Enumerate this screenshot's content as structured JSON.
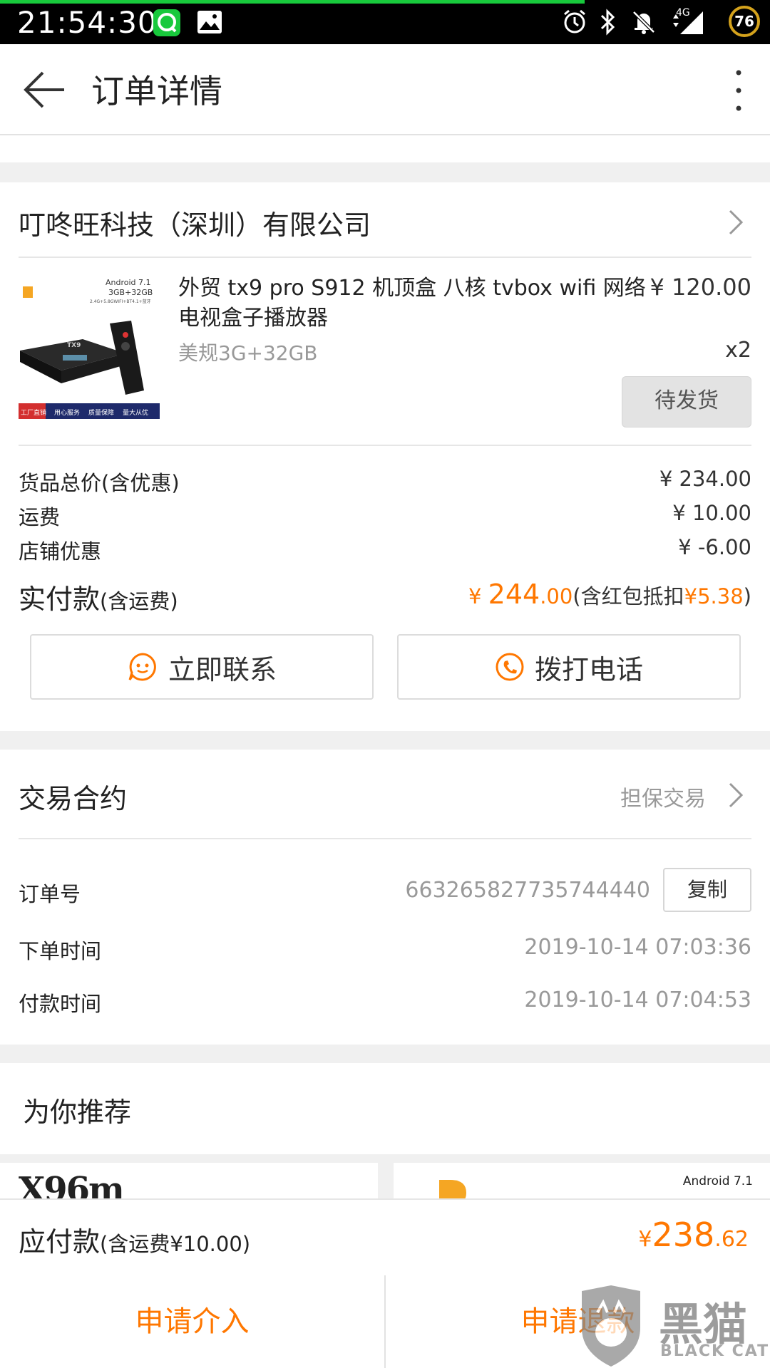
{
  "status_bar": {
    "time": "21:54:30",
    "network": "4G",
    "battery": "76",
    "icons": [
      "chat-notification-icon",
      "gallery-icon",
      "alarm-icon",
      "bluetooth-icon",
      "mute-icon",
      "signal-icon"
    ],
    "accent_color": "#18c93c"
  },
  "header": {
    "title": "订单详情",
    "back_icon": "arrow-left-icon",
    "more_icon": "more-vertical-icon"
  },
  "store": {
    "name": "叮咚旺科技（深圳）有限公司",
    "chevron_icon": "chevron-right-icon"
  },
  "product": {
    "title": "外贸 tx9 pro S912 机顶盒 八核 tvbox wifi 网络电视盒子播放器",
    "price": "¥ 120.00",
    "spec": "美规3G+32GB",
    "quantity": "x2",
    "status_button": "待发货",
    "thumb_text": {
      "android": "Android 7.1",
      "memory": "3GB+32GB",
      "spec_small": "2.4G+5.8GWIFI+BT4.1+蓝牙",
      "brand": "TX9",
      "tags": [
        "工厂直销",
        "用心服务",
        "质量保障",
        "量大从优"
      ]
    }
  },
  "price_summary": {
    "rows": [
      {
        "label": "货品总价(含优惠)",
        "value": "¥ 234.00"
      },
      {
        "label": "运费",
        "value": "¥ 10.00"
      },
      {
        "label": "店铺优惠",
        "value": "¥ -6.00"
      }
    ],
    "paid_label_main": "实付款",
    "paid_label_sub": "(含运费)",
    "paid_currency": "¥ ",
    "paid_int": "244",
    "paid_dec": ".00",
    "paid_note_prefix": "(含红包抵扣",
    "paid_note_amount": "¥5.38",
    "paid_note_suffix": ")"
  },
  "actions": {
    "contact_label": "立即联系",
    "contact_icon": "chat-bubble-icon",
    "call_label": "拨打电话",
    "call_icon": "phone-icon"
  },
  "contract": {
    "title": "交易合约",
    "value": "担保交易",
    "chevron_icon": "chevron-right-icon"
  },
  "order_info": {
    "order_no_label": "订单号",
    "order_no": "663265827735744440",
    "copy_label": "复制",
    "order_time_label": "下单时间",
    "order_time": "2019-10-14 07:03:36",
    "pay_time_label": "付款时间",
    "pay_time": "2019-10-14 07:04:53"
  },
  "recommend": {
    "title": "为你推荐",
    "card1_text": "X96m",
    "card2_text": "Android 7.1"
  },
  "pay_bar": {
    "label_main": "应付款",
    "label_sub": "(含运费¥10.00)",
    "currency": "¥",
    "int": "238",
    "dec": ".62"
  },
  "bottom_bar": {
    "left_label": "申请介入",
    "right_label": "申请退款"
  },
  "watermark": {
    "cn_text": "黑猫",
    "en_text": "BLACK CAT"
  },
  "colors": {
    "accent": "#ff7700",
    "status_green": "#18c93c",
    "text_grey": "#999999"
  }
}
